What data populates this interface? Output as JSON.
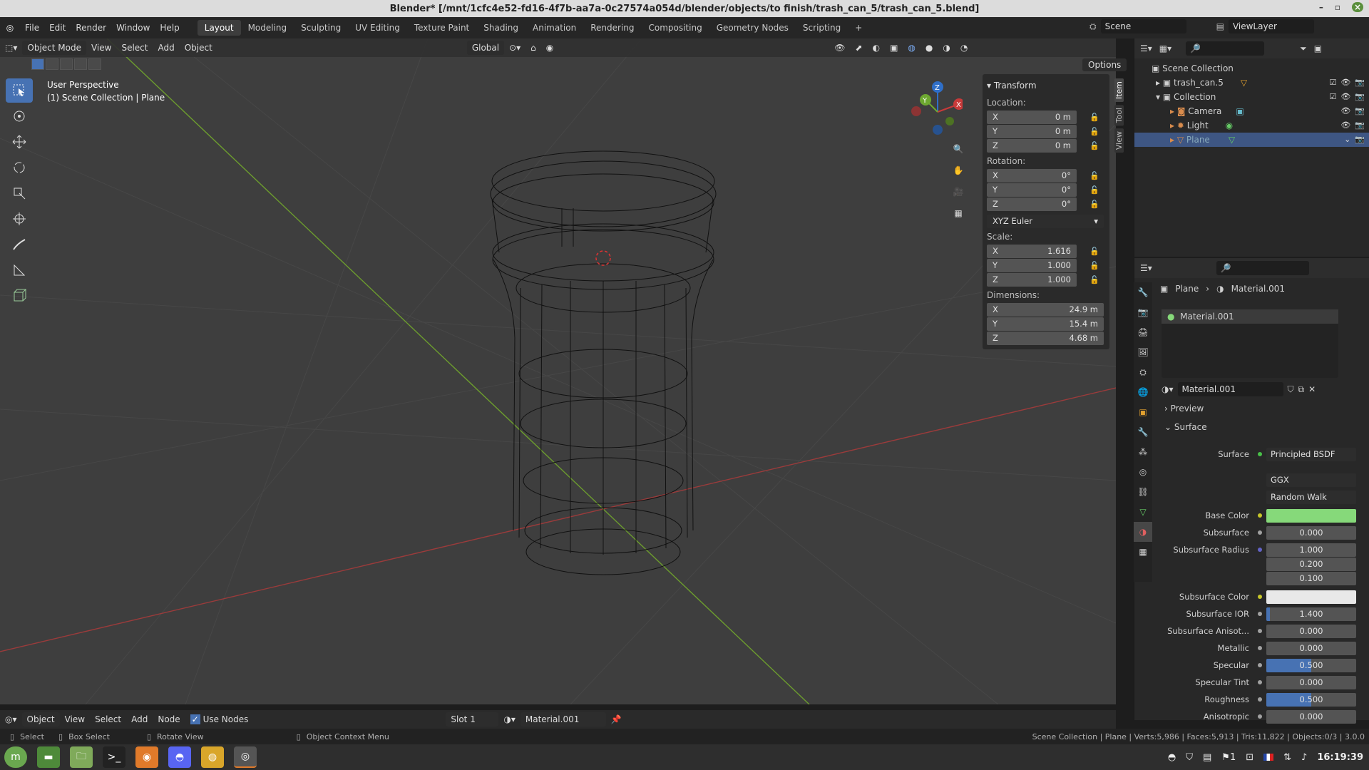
{
  "window": {
    "title": "Blender* [/mnt/1cfc4e52-fd16-4f7b-aa7a-0c27574a054d/blender/objects/to finish/trash_can_5/trash_can_5.blend]"
  },
  "menu": {
    "items": [
      "File",
      "Edit",
      "Render",
      "Window",
      "Help"
    ]
  },
  "workspaces": {
    "tabs": [
      "Layout",
      "Modeling",
      "Sculpting",
      "UV Editing",
      "Texture Paint",
      "Shading",
      "Animation",
      "Rendering",
      "Compositing",
      "Geometry Nodes",
      "Scripting"
    ],
    "plus": "+"
  },
  "scene": {
    "name": "Scene",
    "view_layer": "ViewLayer"
  },
  "viewport": {
    "header": {
      "mode": "Object Mode",
      "menus": [
        "View",
        "Select",
        "Add",
        "Object"
      ],
      "orientation": "Global",
      "options": "Options"
    },
    "label_line1": "User Perspective",
    "label_line2": "(1) Scene Collection | Plane",
    "gizmo": {
      "x": "X",
      "y": "Y",
      "z": "Z"
    }
  },
  "npanel": {
    "tabs": [
      "Item",
      "Tool",
      "View"
    ],
    "transform_title": "Transform",
    "location_label": "Location:",
    "location": [
      {
        "axis": "X",
        "value": "0 m"
      },
      {
        "axis": "Y",
        "value": "0 m"
      },
      {
        "axis": "Z",
        "value": "0 m"
      }
    ],
    "rotation_label": "Rotation:",
    "rotation": [
      {
        "axis": "X",
        "value": "0°"
      },
      {
        "axis": "Y",
        "value": "0°"
      },
      {
        "axis": "Z",
        "value": "0°"
      }
    ],
    "rotation_mode": "XYZ Euler",
    "scale_label": "Scale:",
    "scale": [
      {
        "axis": "X",
        "value": "1.616"
      },
      {
        "axis": "Y",
        "value": "1.000"
      },
      {
        "axis": "Z",
        "value": "1.000"
      }
    ],
    "dimensions_label": "Dimensions:",
    "dimensions": [
      {
        "axis": "X",
        "value": "24.9 m"
      },
      {
        "axis": "Y",
        "value": "15.4 m"
      },
      {
        "axis": "Z",
        "value": "4.68 m"
      }
    ]
  },
  "outliner": {
    "root": "Scene Collection",
    "items": [
      {
        "name": "trash_can.5",
        "indent": 1
      },
      {
        "name": "Collection",
        "indent": 1
      },
      {
        "name": "Camera",
        "indent": 2
      },
      {
        "name": "Light",
        "indent": 2
      },
      {
        "name": "Plane",
        "indent": 2
      }
    ]
  },
  "properties": {
    "breadcrumb_object": "Plane",
    "breadcrumb_material": "Material.001",
    "slot_name": "Material.001",
    "material_name": "Material.001",
    "preview_label": "Preview",
    "surface_section": "Surface",
    "surface_label": "Surface",
    "surface_value": "Principled BSDF",
    "distribution": "GGX",
    "subsurface_method": "Random Walk",
    "rows": [
      {
        "label": "Base Color",
        "value": "",
        "color": "#86d97a"
      },
      {
        "label": "Subsurface",
        "value": "0.000"
      },
      {
        "label": "Subsurface Radius",
        "value": "1.000"
      },
      {
        "label": "",
        "value": "0.200"
      },
      {
        "label": "",
        "value": "0.100"
      },
      {
        "label": "Subsurface Color",
        "value": "",
        "color": "#e8e8e8"
      },
      {
        "label": "Subsurface IOR",
        "value": "1.400",
        "fill": 0.04
      },
      {
        "label": "Subsurface Anisot...",
        "value": "0.000"
      },
      {
        "label": "Metallic",
        "value": "0.000"
      },
      {
        "label": "Specular",
        "value": "0.500",
        "fill": 0.5
      },
      {
        "label": "Specular Tint",
        "value": "0.000"
      },
      {
        "label": "Roughness",
        "value": "0.500",
        "fill": 0.5
      },
      {
        "label": "Anisotropic",
        "value": "0.000"
      }
    ]
  },
  "node_header": {
    "editor": "Object",
    "menus": [
      "View",
      "Select",
      "Add",
      "Node"
    ],
    "use_nodes": "Use Nodes",
    "slot": "Slot 1",
    "material": "Material.001"
  },
  "statusbar": {
    "select": "Select",
    "box_select": "Box Select",
    "rotate_view": "Rotate View",
    "context_menu": "Object Context Menu",
    "stats": "Scene Collection | Plane | Verts:5,986 | Faces:5,913 | Tris:11,822 | Objects:0/3 | 3.0.0"
  },
  "taskbar": {
    "time": "16:19:39",
    "workspace_num": "1"
  }
}
